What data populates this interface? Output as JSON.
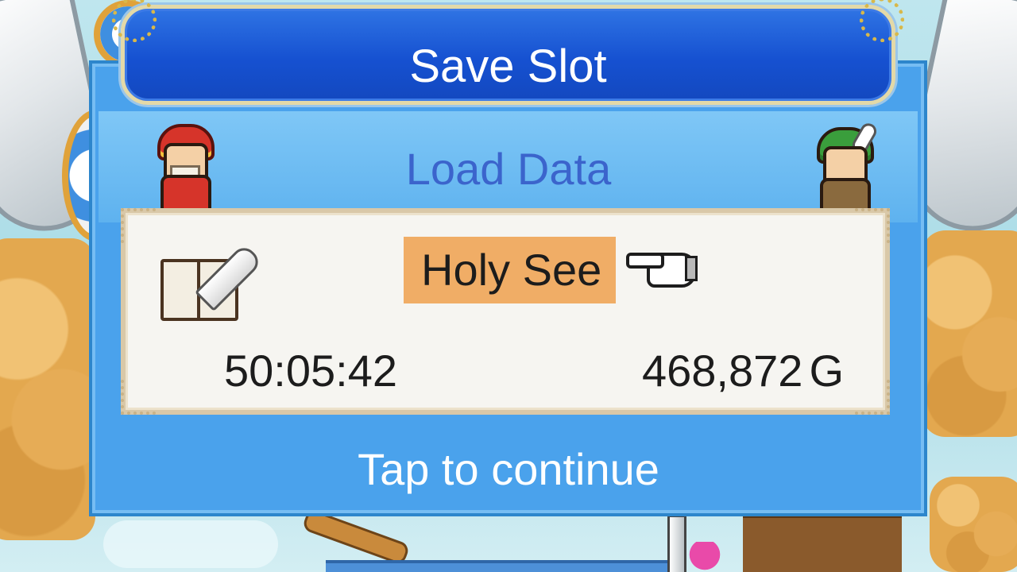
{
  "dialog": {
    "title": "Save Slot",
    "subtitle": "Load Data",
    "footer": "Tap to continue"
  },
  "slot": {
    "name": "Holy See",
    "play_time": "50:05:42",
    "gold_amount": "468,872",
    "gold_unit": "G"
  },
  "icons": {
    "slot": "book-quill-icon",
    "cursor": "pointing-hand-icon",
    "left_character": "king-character",
    "right_character": "ranger-character"
  },
  "colors": {
    "panel": "#4aa2ec",
    "title_bar": "#1651d1",
    "subtitle": "#3b64cc",
    "highlight": "#f0ad66",
    "card": "#f6f5f1"
  }
}
